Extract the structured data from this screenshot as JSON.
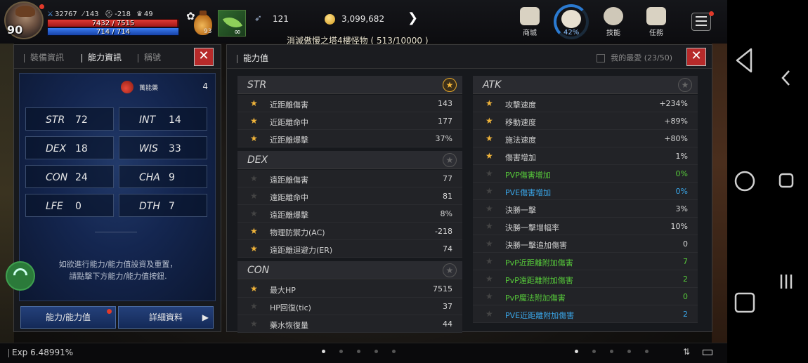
{
  "hud": {
    "level": "90",
    "stat1": "32767",
    "stat2": "143",
    "stat3": "-218",
    "stat4": "49",
    "hp_text": "7432 / 7515",
    "hp_pct": 0.989,
    "mp_text": "714 / 714",
    "mp_pct": 1.0,
    "potion_count": "93",
    "infinity": "∞",
    "wing_count": "121",
    "gold": "3,099,682",
    "quest": "消滅傲慢之塔4樓怪物 ( 513/10000 )",
    "ring_pct": "42%",
    "buttons": [
      {
        "label": "商城"
      },
      {
        "label": "技能"
      },
      {
        "label": "任務"
      }
    ]
  },
  "left_panel": {
    "tabs": [
      "裝備資訊",
      "能力資訊",
      "稱號"
    ],
    "active_tab": 1,
    "elixir_label": "萬能藥",
    "elixir_count": "4",
    "stats": [
      {
        "key": "STR",
        "value": "72"
      },
      {
        "key": "INT",
        "value": "14"
      },
      {
        "key": "DEX",
        "value": "18"
      },
      {
        "key": "WIS",
        "value": "33"
      },
      {
        "key": "CON",
        "value": "24"
      },
      {
        "key": "CHA",
        "value": "9"
      },
      {
        "key": "LFE",
        "value": "0"
      },
      {
        "key": "DTH",
        "value": "7"
      }
    ],
    "hint_line1": "如欲進行能力/能力值設資及重置，",
    "hint_line2": "請點擊下方能力/能力值按鈕.",
    "btn_ability": "能力/能力值",
    "btn_detail": "詳細資料"
  },
  "right_panel": {
    "title": "能力值",
    "favorites": "我的最愛 (23/50)",
    "left_column": [
      {
        "section": "STR",
        "starred": true,
        "rows": [
          {
            "label": "近距離傷害",
            "value": "143",
            "star": true,
            "color": "normal"
          },
          {
            "label": "近距離命中",
            "value": "177",
            "star": true,
            "color": "normal"
          },
          {
            "label": "近距離爆擊",
            "value": "37%",
            "star": true,
            "color": "normal"
          }
        ]
      },
      {
        "section": "DEX",
        "starred": false,
        "rows": [
          {
            "label": "遠距離傷害",
            "value": "77",
            "star": false,
            "color": "normal"
          },
          {
            "label": "遠距離命中",
            "value": "81",
            "star": false,
            "color": "normal"
          },
          {
            "label": "遠距離爆擊",
            "value": "8%",
            "star": false,
            "color": "normal"
          },
          {
            "label": "物理防禦力(AC)",
            "value": "-218",
            "star": true,
            "color": "normal"
          },
          {
            "label": "遠距離迴避力(ER)",
            "value": "74",
            "star": true,
            "color": "normal"
          }
        ]
      },
      {
        "section": "CON",
        "starred": false,
        "rows": [
          {
            "label": "最大HP",
            "value": "7515",
            "star": true,
            "color": "normal"
          },
          {
            "label": "HP回復(tic)",
            "value": "37",
            "star": false,
            "color": "normal"
          },
          {
            "label": "藥水恢復量",
            "value": "44",
            "star": false,
            "color": "normal"
          }
        ]
      }
    ],
    "right_column": [
      {
        "section": "ATK",
        "starred": false,
        "rows": [
          {
            "label": "攻擊速度",
            "value": "+234%",
            "star": true,
            "color": "normal"
          },
          {
            "label": "移動速度",
            "value": "+89%",
            "star": true,
            "color": "normal"
          },
          {
            "label": "施法速度",
            "value": "+80%",
            "star": true,
            "color": "normal"
          },
          {
            "label": "傷害增加",
            "value": "1%",
            "star": true,
            "color": "normal"
          },
          {
            "label": "PVP傷害增加",
            "value": "0%",
            "star": false,
            "color": "green"
          },
          {
            "label": "PVE傷害增加",
            "value": "0%",
            "star": false,
            "color": "blue"
          },
          {
            "label": "決勝一擊",
            "value": "3%",
            "star": false,
            "color": "normal"
          },
          {
            "label": "決勝一擊增幅率",
            "value": "10%",
            "star": false,
            "color": "normal"
          },
          {
            "label": "決勝一擊追加傷害",
            "value": "0",
            "star": false,
            "color": "normal"
          },
          {
            "label": "PvP近距離附加傷害",
            "value": "7",
            "star": false,
            "color": "green"
          },
          {
            "label": "PvP遠距離附加傷害",
            "value": "2",
            "star": false,
            "color": "green"
          },
          {
            "label": "PvP魔法附加傷害",
            "value": "0",
            "star": false,
            "color": "green"
          },
          {
            "label": "PVE近距離附加傷害",
            "value": "2",
            "star": false,
            "color": "blue"
          }
        ]
      }
    ]
  },
  "bottom": {
    "exp_label": "Exp",
    "exp_value": "6.48991%"
  },
  "colors": {
    "accent_gold": "#f0b43a",
    "close_red": "#b72a2a",
    "pvp_green": "#56c93a",
    "pve_blue": "#3aa6e8"
  }
}
